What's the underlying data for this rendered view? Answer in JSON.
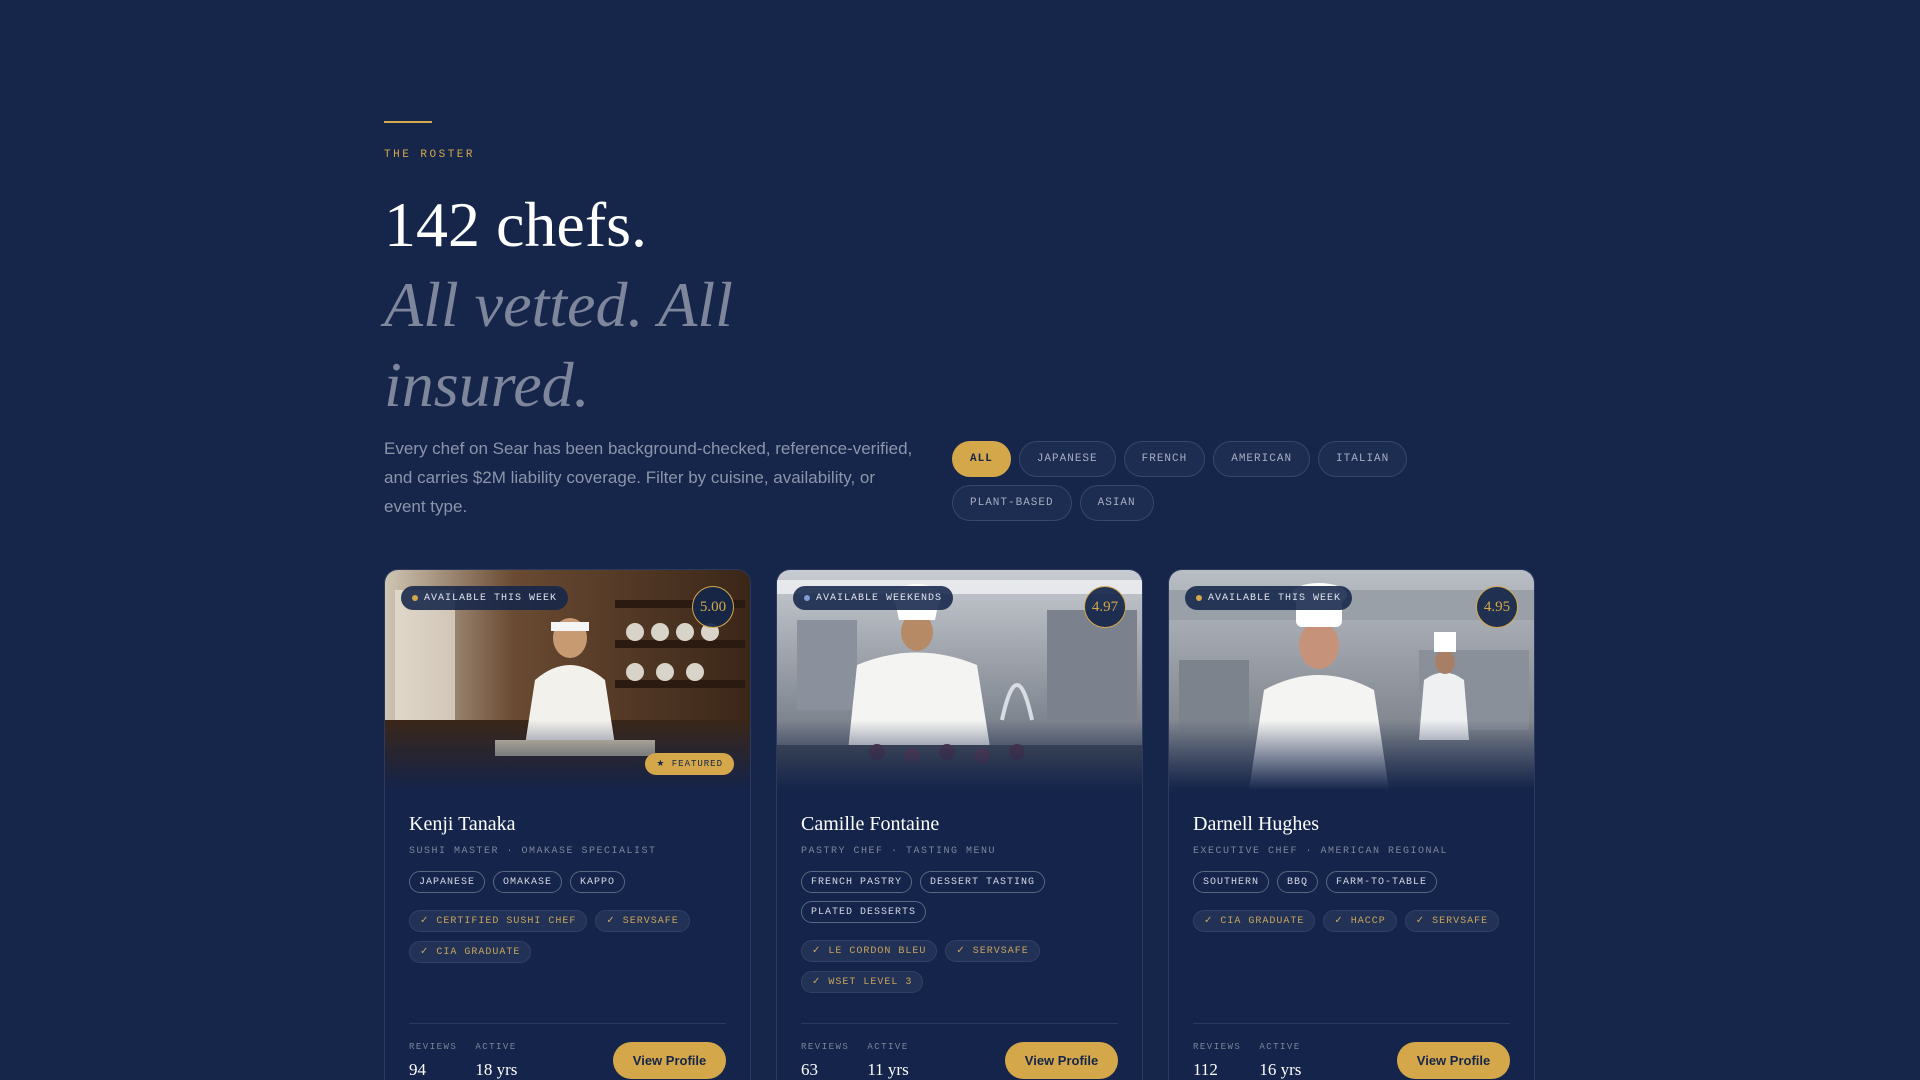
{
  "hero": {
    "eyebrow": "THE ROSTER",
    "title": "142 chefs.",
    "subtitle": "All vetted. All insured.",
    "intro": "Every chef on Sear has been background-checked, reference-verified, and carries $2M liability coverage. Filter by cuisine, availability, or event type."
  },
  "filters": [
    "ALL",
    "JAPANESE",
    "FRENCH",
    "AMERICAN",
    "ITALIAN",
    "PLANT-BASED",
    "ASIAN"
  ],
  "active_filter": "ALL",
  "colors": {
    "accent": "#d4a84a",
    "background": "#15264a"
  },
  "cards": [
    {
      "availability": "AVAILABLE THIS WEEK",
      "rating": "5.00",
      "featured": "★ FEATURED",
      "name": "Kenji Tanaka",
      "role": "SUSHI MASTER · OMAKASE SPECIALIST",
      "tags": [
        "JAPANESE",
        "OMAKASE",
        "KAPPO"
      ],
      "certs": [
        "✓ CERTIFIED SUSHI CHEF",
        "✓ SERVSAFE",
        "✓ CIA GRADUATE"
      ],
      "reviews_label": "REVIEWS",
      "reviews": "94",
      "active_label": "ACTIVE",
      "active": "18 yrs",
      "cta": "View Profile",
      "photo": "sushi-chef-photo"
    },
    {
      "availability": "AVAILABLE WEEKENDS",
      "rating": "4.97",
      "name": "Camille Fontaine",
      "role": "PASTRY CHEF · TASTING MENU",
      "tags": [
        "FRENCH PASTRY",
        "DESSERT TASTING",
        "PLATED DESSERTS"
      ],
      "certs": [
        "✓ LE CORDON BLEU",
        "✓ SERVSAFE",
        "✓ WSET LEVEL 3"
      ],
      "reviews_label": "REVIEWS",
      "reviews": "63",
      "active_label": "ACTIVE",
      "active": "11 yrs",
      "cta": "View Profile",
      "photo": "pastry-chef-photo"
    },
    {
      "availability": "AVAILABLE THIS WEEK",
      "rating": "4.95",
      "name": "Darnell Hughes",
      "role": "EXECUTIVE CHEF · AMERICAN REGIONAL",
      "tags": [
        "SOUTHERN",
        "BBQ",
        "FARM-TO-TABLE"
      ],
      "certs": [
        "✓ CIA GRADUATE",
        "✓ HACCP",
        "✓ SERVSAFE"
      ],
      "reviews_label": "REVIEWS",
      "reviews": "112",
      "active_label": "ACTIVE",
      "active": "16 yrs",
      "cta": "View Profile",
      "photo": "executive-chef-photo"
    }
  ]
}
